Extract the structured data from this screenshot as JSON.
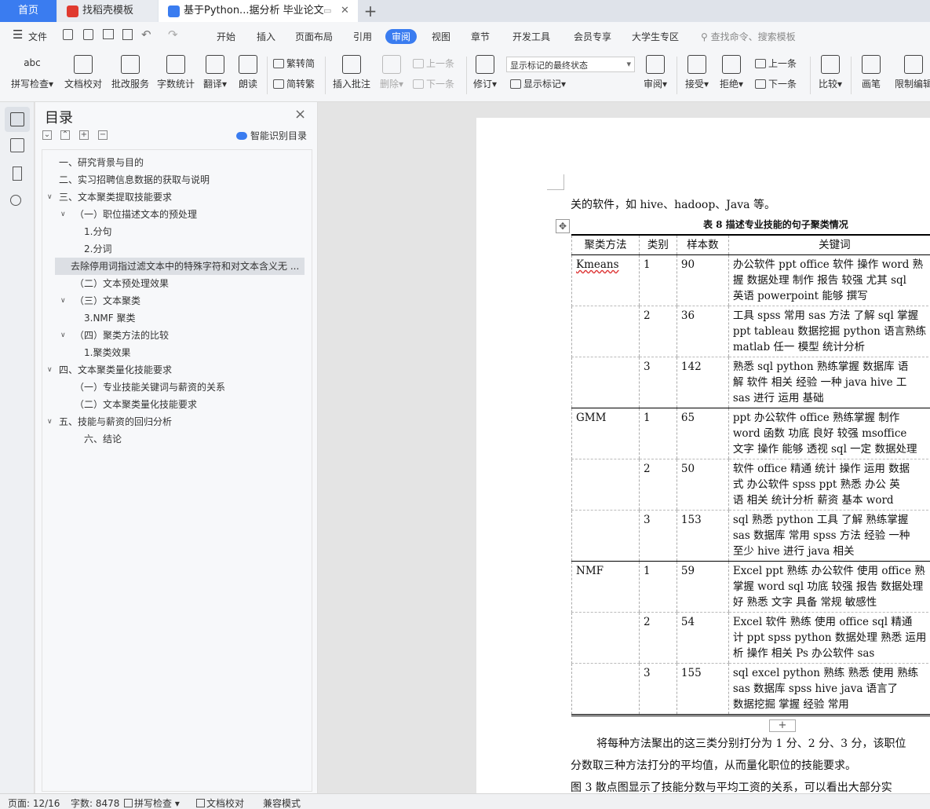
{
  "tabs": {
    "home": "首页",
    "template": "找稻壳模板",
    "document": "基于Python...据分析 毕业论文",
    "add": "+"
  },
  "menubar": {
    "file": "文件",
    "items": [
      "开始",
      "插入",
      "页面布局",
      "引用",
      "审阅",
      "视图",
      "章节",
      "开发工具",
      "会员专享",
      "大学生专区"
    ],
    "search": "查找命令、搜索模板"
  },
  "ribbon": {
    "spell": "拼写检查",
    "abc": "abc",
    "proof": "文档校对",
    "approval": "批改服务",
    "wordcount": "字数统计",
    "translate": "翻译",
    "read": "朗读",
    "trad": "繁转简",
    "simp": "简转繁",
    "insert_comment": "插入批注",
    "delete": "删除",
    "prev_comment": "上一条",
    "next_comment": "下一条",
    "revise": "修订",
    "markup_mode": "显示标记的最终状态",
    "show_markup": "显示标记",
    "review": "审阅",
    "accept": "接受",
    "reject": "拒绝",
    "prev": "上一条",
    "next": "下一条",
    "compare": "比较",
    "pen": "画笔",
    "restrict": "限制编辑"
  },
  "outline": {
    "title": "目录",
    "smart": "智能识别目录",
    "close": "×",
    "items": [
      {
        "text": "一、研究背景与目的"
      },
      {
        "text": "二、实习招聘信息数据的获取与说明"
      },
      {
        "text": "三、文本聚类提取技能要求"
      },
      {
        "text": "（一）职位描述文本的预处理"
      },
      {
        "text": "1.分句"
      },
      {
        "text": "2.分词"
      },
      {
        "text": "去除停用词指过滤文本中的特殊字符和对文本含义无 ..."
      },
      {
        "text": "（二）文本预处理效果"
      },
      {
        "text": "（三）文本聚类"
      },
      {
        "text": "3.NMF 聚类"
      },
      {
        "text": "（四）聚类方法的比较"
      },
      {
        "text": "1.聚类效果"
      },
      {
        "text": "四、文本聚类量化技能要求"
      },
      {
        "text": "（一）专业技能关键词与薪资的关系"
      },
      {
        "text": "（二）文本聚类量化技能要求"
      },
      {
        "text": "五、技能与薪资的回归分析"
      },
      {
        "text": "六、结论"
      }
    ]
  },
  "doc": {
    "line_top": "关的软件，如 hive、hadoop、Java 等。",
    "caption": "表 8 描述专业技能的句子聚类情况",
    "headers": [
      "聚类方法",
      "类别",
      "样本数",
      "关键词"
    ],
    "rows": [
      {
        "method": "Kmeans",
        "cat": "1",
        "n": "90",
        "kw": [
          "办公软件 ppt office 软件 操作 word 熟",
          "握 数据处理 制作 报告 较强 尤其 sql",
          "英语 powerpoint 能够 撰写"
        ]
      },
      {
        "method": "",
        "cat": "2",
        "n": "36",
        "kw": [
          "工具 spss 常用 sas 方法 了解 sql 掌握",
          "ppt tableau 数据挖掘 python 语言熟练",
          "matlab 任一 模型 统计分析"
        ]
      },
      {
        "method": "",
        "cat": "3",
        "n": "142",
        "kw": [
          "熟悉 sql python 熟练掌握 数据库 语",
          "解 软件 相关 经验 一种 java hive 工",
          "sas 进行 运用 基础"
        ]
      },
      {
        "method": "GMM",
        "cat": "1",
        "n": "65",
        "kw": [
          "ppt 办公软件 office 熟练掌握 制作",
          "word 函数 功底 良好 较强 msoffice",
          "文字 操作 能够 透视 sql 一定 数据处理"
        ]
      },
      {
        "method": "",
        "cat": "2",
        "n": "50",
        "kw": [
          "软件 office 精通 统计 操作 运用 数据",
          "式 办公软件 spss ppt 熟悉 办公 英",
          "语 相关 统计分析 薪资 基本 word"
        ]
      },
      {
        "method": "",
        "cat": "3",
        "n": "153",
        "kw": [
          "sql 熟悉 python 工具 了解 熟练掌握",
          "sas 数据库 常用 spss 方法 经验 一种",
          "至少 hive 进行 java 相关"
        ]
      },
      {
        "method": "NMF",
        "cat": "1",
        "n": "59",
        "kw": [
          "Excel ppt 熟练 办公软件 使用 office 熟",
          "掌握 word sql 功底 较强 报告 数据处理",
          "好 熟悉 文字 具备 常规 敏感性"
        ]
      },
      {
        "method": "",
        "cat": "2",
        "n": "54",
        "kw": [
          "Excel 软件 熟练 使用 office sql 精通",
          "计 ppt spss python 数据处理 熟悉 运用",
          "析 操作 相关 Ps 办公软件 sas"
        ]
      },
      {
        "method": "",
        "cat": "3",
        "n": "155",
        "kw": [
          "sql excel python 熟练 熟悉 使用 熟练",
          "sas 数据库 spss hive java 语言了",
          "数据挖掘 掌握 经验 常用"
        ]
      }
    ],
    "para1": "将每种方法聚出的这三类分别打分为 1 分、2 分、3 分，该职位",
    "para2": "分数取三种方法打分的平均值，从而量化职位的技能要求。",
    "para3": "图 3 散点图显示了技能分数与平均工资的关系，可以看出大部分实"
  },
  "status": {
    "page": "页面: 12/16",
    "words": "字数: 8478",
    "spell": "拼写检查",
    "proof": "文档校对",
    "compat": "兼容模式"
  },
  "colors": {
    "accent": "#3a7cf0"
  }
}
